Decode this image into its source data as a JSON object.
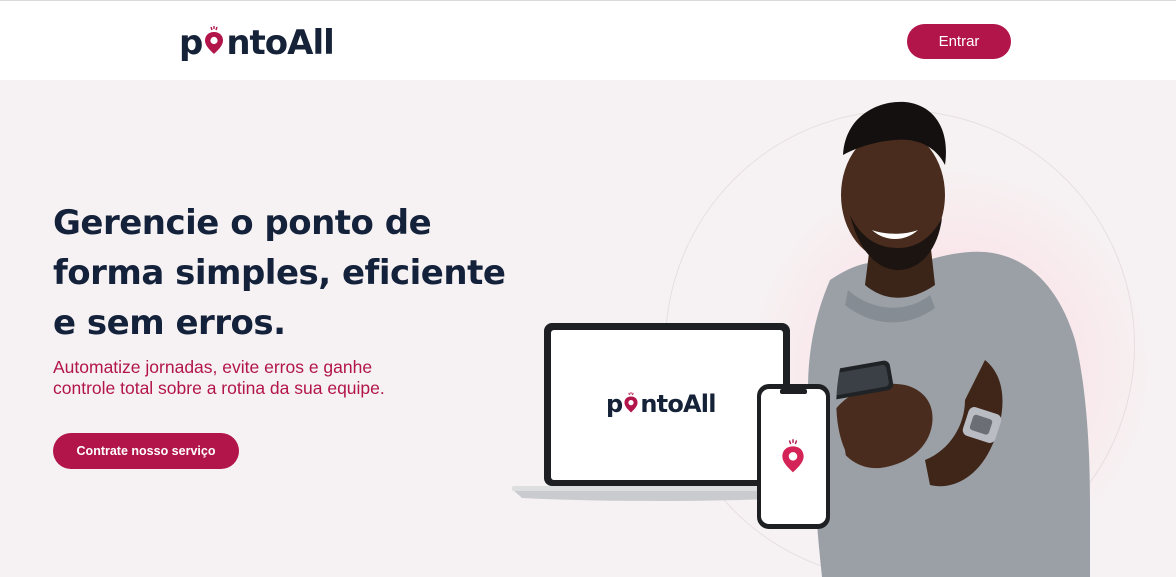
{
  "header": {
    "logo": {
      "prefix": "p",
      "suffix": "ntoAll",
      "icon": "map-pin-icon"
    },
    "login_label": "Entrar"
  },
  "hero": {
    "headline_lines": [
      "Gerencie o ponto de",
      "forma simples, eficiente",
      "e sem erros."
    ],
    "subtitle_lines": [
      "Automatize jornadas, evite erros e ganhe",
      "controle total sobre a rotina da sua equipe."
    ],
    "cta_label": "Contrate nosso serviço"
  },
  "devices": {
    "laptop_logo": {
      "prefix": "p",
      "suffix": "ntoAll"
    },
    "phone_icon": "map-pin-icon"
  },
  "colors": {
    "brand": "#b2154a",
    "navy": "#14213a",
    "background": "#f6f2f3"
  }
}
